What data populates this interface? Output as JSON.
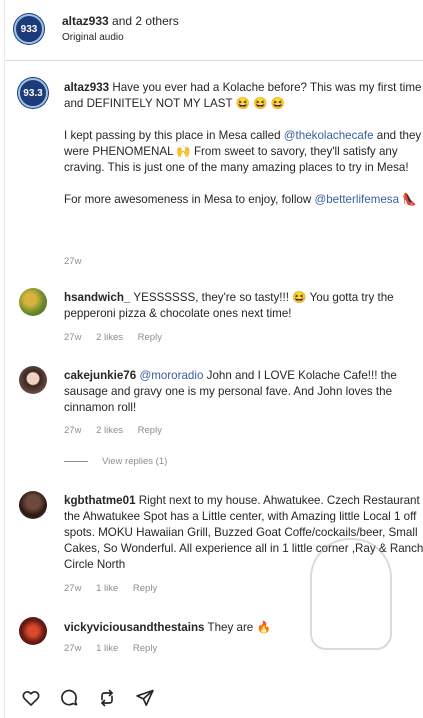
{
  "header": {
    "username": "altaz933",
    "others": "and 2 others",
    "subtitle": "Original audio",
    "avatar_text": "933"
  },
  "caption": {
    "avatar_text": "93.3",
    "username": "altaz933",
    "p1": "Have you ever had a Kolache before? This was my first time and DEFINITELY NOT MY LAST 😆 😆 😆",
    "p2_before": "I kept passing by this place in Mesa called ",
    "p2_mention": "@thekolachecafe",
    "p2_after": " and they were PHENOMENAL 🙌 From sweet to savory, they'll satisfy any craving. This is just one of the many amazing places to try in Mesa!",
    "p3_before": "For more awesomeness in Mesa to enjoy, follow ",
    "p3_mention": "@betterlifemesa",
    "p3_after": " 👠",
    "time": "27w"
  },
  "comments": [
    {
      "username": "hsandwich_",
      "text": "YESSSSSS, they're so tasty!!! 😆 You gotta try the pepperoni pizza & chocolate ones next time!",
      "time": "27w",
      "likes": "2 likes",
      "reply": "Reply"
    },
    {
      "username": "cakejunkie76",
      "mention": "@mororadio",
      "text": "John and I LOVE Kolache Cafe!!! the sausage and gravy one is my personal fave. And John loves the cinnamon roll!",
      "time": "27w",
      "likes": "2 likes",
      "reply": "Reply",
      "view_replies": "View replies (1)"
    },
    {
      "username": "kgbthatme01",
      "text": "Right next to my house. Ahwatukee. Czech Restaurant & the Ahwatukee Spot has a Little center, with Amazing little Local 1 off spots. MOKU Hawaiian Grill, Buzzed Goat Coffe/cockails/beer, Small Cakes, So Wonderful. All experience all in 1 little corner ,Ray & Ranch Circle North",
      "time": "27w",
      "likes": "1 like",
      "reply": "Reply"
    },
    {
      "username": "vickyviciousandthestains",
      "text": "They are 🔥",
      "time": "27w",
      "likes": "1 like",
      "reply": "Reply"
    }
  ],
  "actions": [
    "heart-icon",
    "comment-icon",
    "repost-icon",
    "share-icon"
  ]
}
